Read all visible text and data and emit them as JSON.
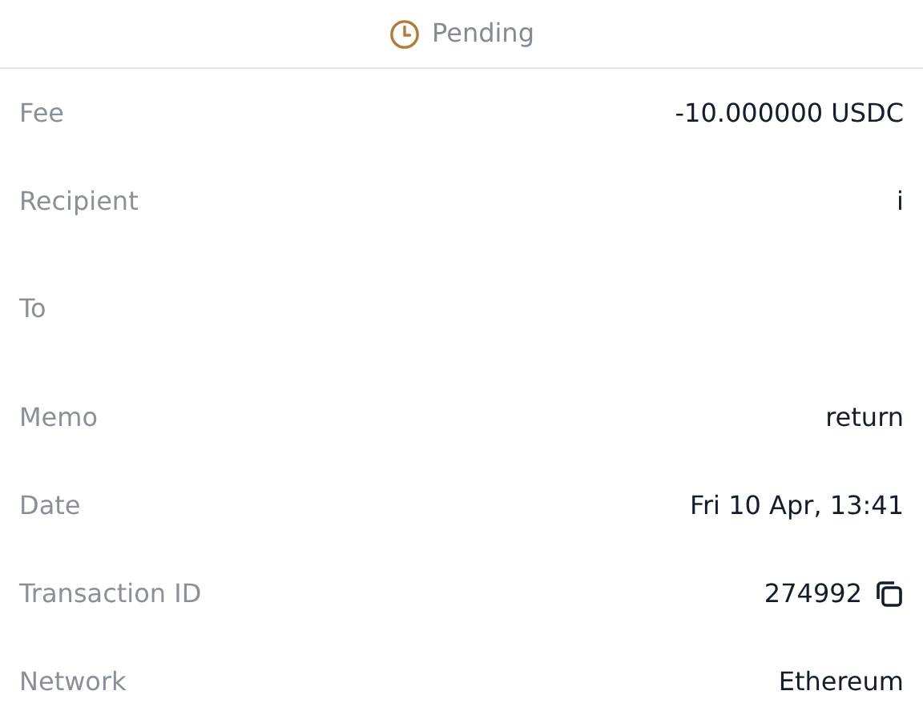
{
  "status": {
    "label": "Pending"
  },
  "details": [
    {
      "label": "Fee",
      "value": "-10.000000 USDC"
    },
    {
      "label": "Recipient",
      "value": "i"
    },
    {
      "label": "To",
      "kind": "tall"
    },
    {
      "label": "Memo",
      "value": "return"
    },
    {
      "label": "Date",
      "value": "Fri 10 Apr, 13:41"
    },
    {
      "label": "Transaction ID",
      "value": "274992",
      "kind": "copy"
    },
    {
      "label": "Network",
      "value": "Ethereum"
    }
  ]
}
